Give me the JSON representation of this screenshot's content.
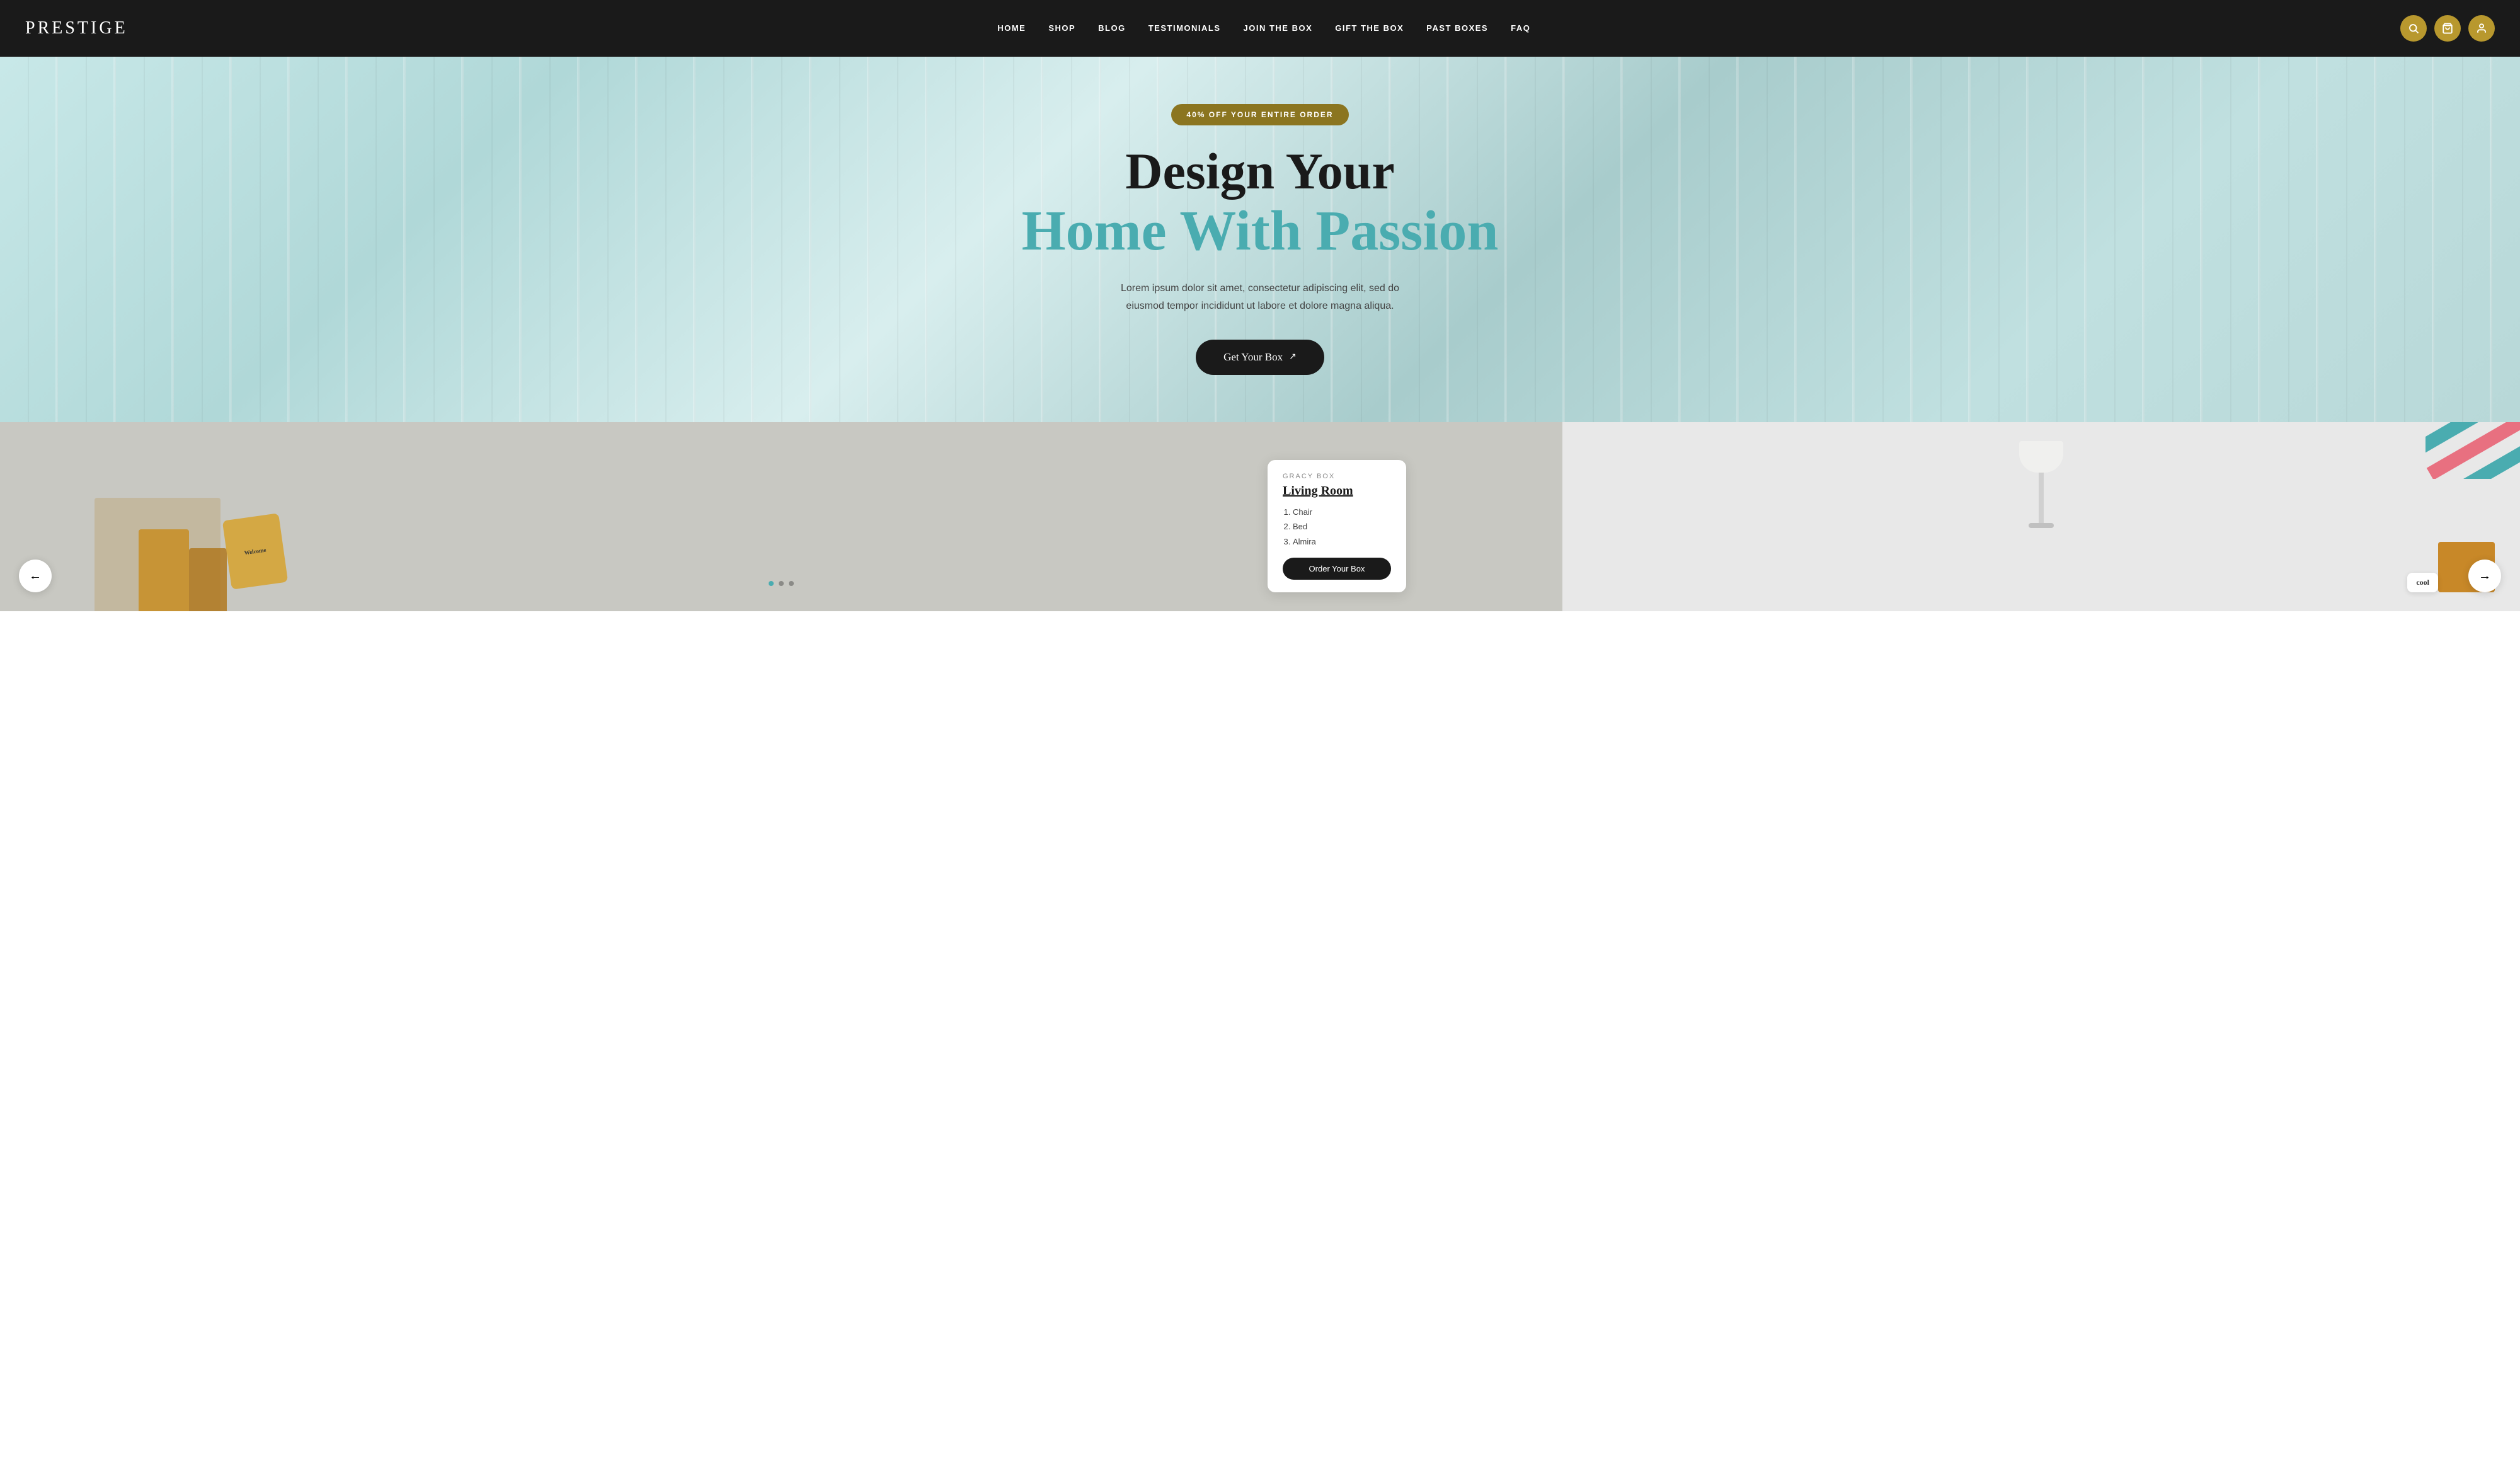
{
  "navbar": {
    "logo": "PRESTIGE",
    "nav_items": [
      {
        "label": "HOME",
        "id": "home"
      },
      {
        "label": "SHOP",
        "id": "shop"
      },
      {
        "label": "BLOG",
        "id": "blog"
      },
      {
        "label": "TESTIMONIALS",
        "id": "testimonials"
      },
      {
        "label": "JOIN THE BOX",
        "id": "join"
      },
      {
        "label": "GIFT THE BOX",
        "id": "gift"
      },
      {
        "label": "PAST BOXES",
        "id": "past"
      },
      {
        "label": "FAQ",
        "id": "faq"
      }
    ],
    "icons": {
      "search": "🔍",
      "cart": "🛍",
      "user": "👤"
    }
  },
  "hero": {
    "badge": "40% OFF YOUR ENTIRE ORDER",
    "title_line1": "Design Your",
    "title_line2": "Home With Passion",
    "subtitle": "Lorem ipsum dolor sit amet, consectetur adipiscing elit, sed do eiusmod tempor incididunt ut labore et dolore magna aliqua.",
    "cta_label": "Get Your Box",
    "cta_icon": "↗"
  },
  "product_card": {
    "brand": "GRACY BOX",
    "title": "Living Room",
    "items": [
      "Chair",
      "Bed",
      "Almira"
    ],
    "cta": "Order Your Box",
    "cool_label": "cool"
  },
  "navigation": {
    "prev_icon": "←",
    "next_icon": "→"
  },
  "colors": {
    "navbar_bg": "#1a1a1a",
    "accent_gold": "#b8982e",
    "accent_teal": "#4aacb0",
    "hero_text_dark": "#1a1a1a",
    "card_cta_bg": "#1a1a1a"
  }
}
